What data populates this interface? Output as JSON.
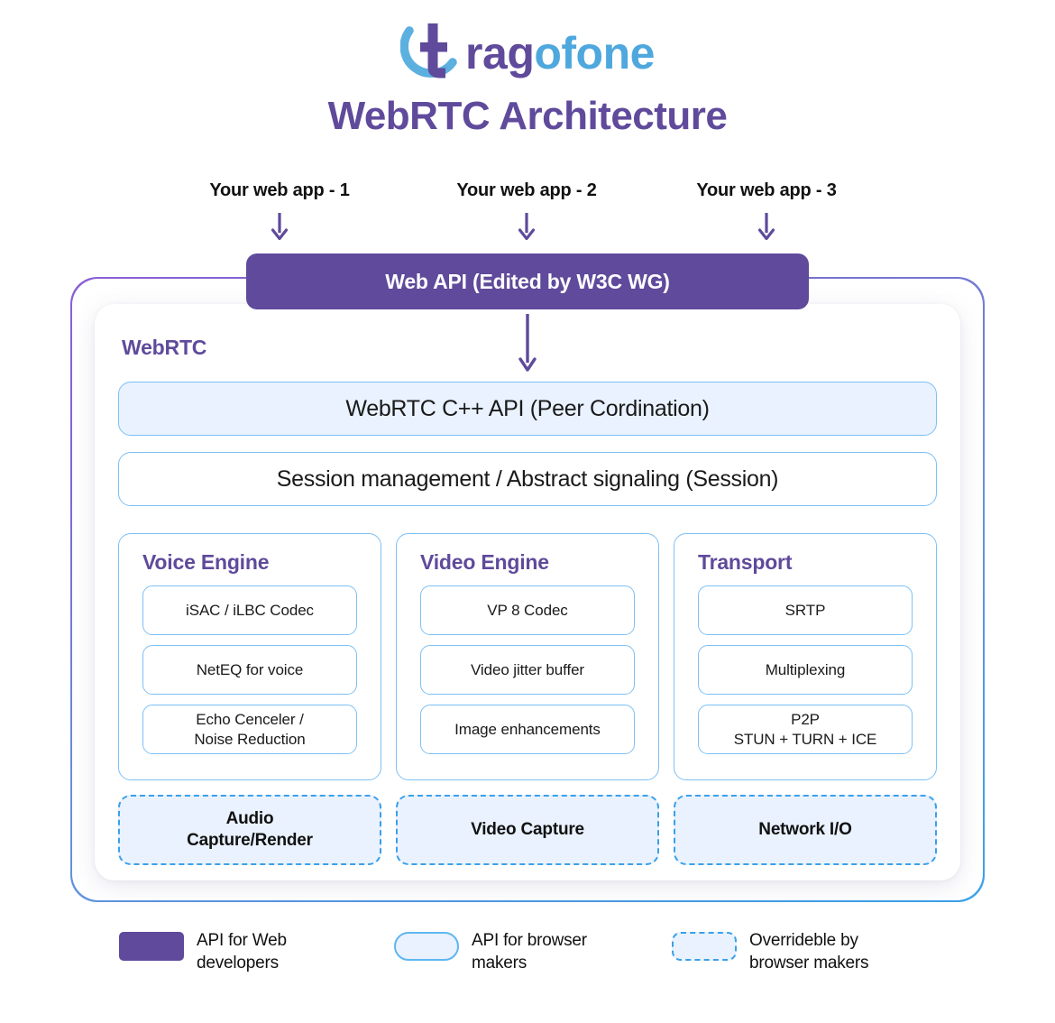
{
  "brand": {
    "name_dark": "t",
    "name_mid": "rag",
    "name_light": "ofone",
    "logo_icon": "tragofone-swoosh-logo",
    "colors": {
      "purple": "#5f4a9b",
      "blue": "#4fa8dd",
      "light_blue_fill": "#e9f2fe",
      "border_blue": "#7dc0f5",
      "dashed_blue": "#3aa0ea"
    }
  },
  "title": "WebRTC Architecture",
  "webapps": [
    {
      "label": "Your web app - 1",
      "arrow": "arrow-down-icon"
    },
    {
      "label": "Your web app - 2",
      "arrow": "arrow-down-icon"
    },
    {
      "label": "Your web app - 3",
      "arrow": "arrow-down-icon"
    }
  ],
  "web_api_bar": "Web API (Edited by W3C WG)",
  "webrtc_label": "WebRTC",
  "stack": {
    "cpp_api": "WebRTC C++ API (Peer Cordination)",
    "session": "Session management / Abstract signaling (Session)"
  },
  "engines": [
    {
      "title": "Voice Engine",
      "items": [
        {
          "line1": "iSAC / iLBC Codec",
          "line2": ""
        },
        {
          "line1": "NetEQ for voice",
          "line2": ""
        },
        {
          "line1": "Echo Cenceler /",
          "line2": "Noise Reduction"
        }
      ]
    },
    {
      "title": "Video Engine",
      "items": [
        {
          "line1": "VP 8 Codec",
          "line2": ""
        },
        {
          "line1": "Video jitter buffer",
          "line2": ""
        },
        {
          "line1": "Image enhancements",
          "line2": ""
        }
      ]
    },
    {
      "title": "Transport",
      "items": [
        {
          "line1": "SRTP",
          "line2": ""
        },
        {
          "line1": "Multiplexing",
          "line2": ""
        },
        {
          "line1": "P2P",
          "line2": "STUN + TURN + ICE"
        }
      ]
    }
  ],
  "overridable": [
    {
      "line1": "Audio",
      "line2": "Capture/Render"
    },
    {
      "line1": "Video Capture",
      "line2": ""
    },
    {
      "line1": "Network I/O",
      "line2": ""
    }
  ],
  "legend": [
    {
      "swatch": "solid-purple-swatch",
      "text": "API for Web\ndevelopers"
    },
    {
      "swatch": "rounded-lightblue-swatch",
      "text": "API for browser\nmakers"
    },
    {
      "swatch": "dashed-lightblue-swatch",
      "text": "Overrideble by\nbrowser makers"
    }
  ]
}
